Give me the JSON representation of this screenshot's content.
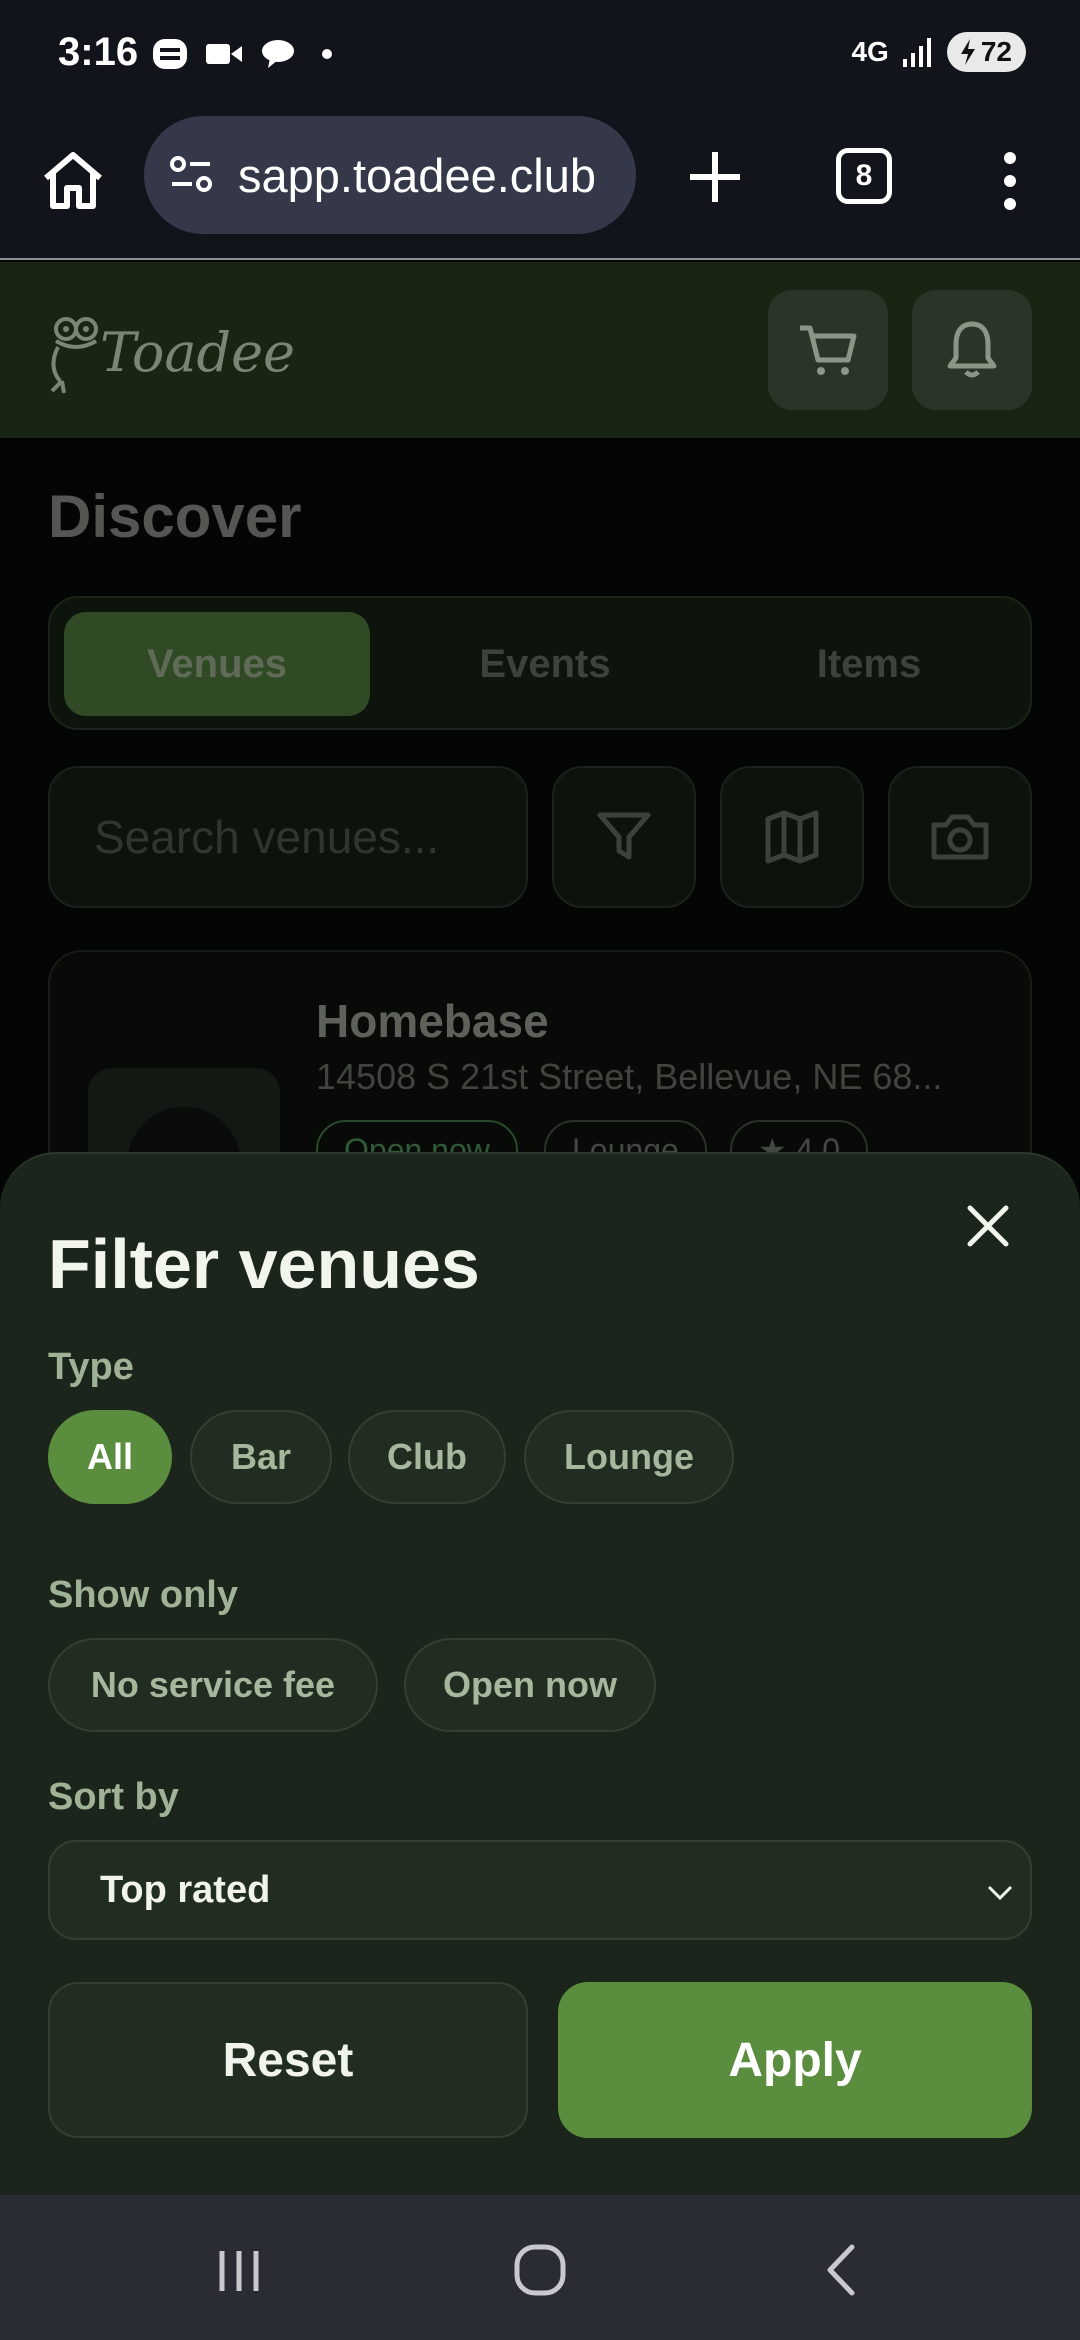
{
  "status_bar": {
    "time": "3:16",
    "network": "4G",
    "battery": "72",
    "icons": [
      "app-notification-icon",
      "video-icon",
      "chat-icon",
      "dot-icon",
      "signal-icon",
      "battery-icon"
    ]
  },
  "browser": {
    "url": "sapp.toadee.club",
    "tab_count": "8",
    "icons": [
      "home-icon",
      "site-settings-icon",
      "plus-icon",
      "tabs-icon",
      "more-icon"
    ]
  },
  "app_header": {
    "logo_text": "Toadee",
    "icons": [
      "cart-icon",
      "bell-icon"
    ]
  },
  "discover": {
    "title": "Discover",
    "tabs": [
      {
        "label": "Venues",
        "active": true
      },
      {
        "label": "Events",
        "active": false
      },
      {
        "label": "Items",
        "active": false
      }
    ],
    "search_placeholder": "Search venues...",
    "tool_icons": [
      "filter-icon",
      "map-icon",
      "camera-icon"
    ],
    "venue": {
      "name": "Homebase",
      "address": "14508 S 21st Street, Bellevue, NE 68...",
      "chips": [
        "Open now",
        "Lounge",
        "★ 4.0"
      ]
    }
  },
  "filter_sheet": {
    "title": "Filter venues",
    "type_label": "Type",
    "type_options": [
      {
        "label": "All",
        "active": true
      },
      {
        "label": "Bar",
        "active": false
      },
      {
        "label": "Club",
        "active": false
      },
      {
        "label": "Lounge",
        "active": false
      }
    ],
    "show_only_label": "Show only",
    "show_only_options": [
      {
        "label": "No service fee",
        "active": false
      },
      {
        "label": "Open now",
        "active": false
      }
    ],
    "sort_label": "Sort by",
    "sort_value": "Top rated",
    "reset_label": "Reset",
    "apply_label": "Apply"
  },
  "colors": {
    "accent": "#5b8d3e",
    "sheet_background": "#1b251c",
    "header_background": "#172512"
  }
}
